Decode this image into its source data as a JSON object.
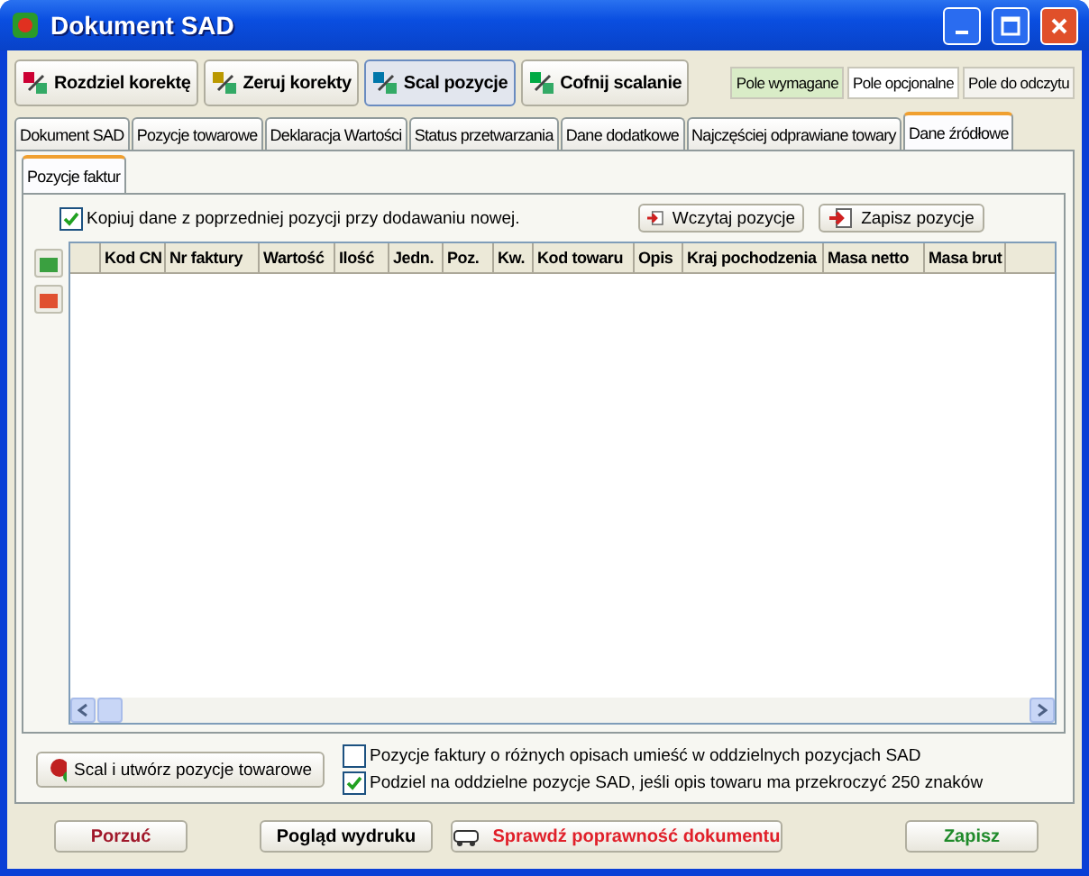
{
  "window": {
    "title": "Dokument SAD"
  },
  "toolbar": [
    {
      "label": "Rozdziel korektę",
      "pressed": false
    },
    {
      "label": "Zeruj korekty",
      "pressed": false
    },
    {
      "label": "Scal pozycje",
      "pressed": true
    },
    {
      "label": "Cofnij scalanie",
      "pressed": false
    }
  ],
  "legend": [
    {
      "label": "Pole wymagane",
      "color": "#d9ecc7"
    },
    {
      "label": "Pole opcjonalne",
      "color": "#ffffff"
    },
    {
      "label": "Pole do odczytu",
      "color": "#f4f3ee"
    }
  ],
  "tabs": [
    {
      "label": "Dokument SAD",
      "selected": false
    },
    {
      "label": "Pozycje towarowe",
      "selected": false
    },
    {
      "label": "Deklaracja Wartości",
      "selected": false
    },
    {
      "label": "Status przetwarzania",
      "selected": false
    },
    {
      "label": "Dane dodatkowe",
      "selected": false
    },
    {
      "label": "Najczęściej odprawiane towary",
      "selected": false
    },
    {
      "label": "Dane źródłowe",
      "selected": true
    }
  ],
  "subtabs": [
    {
      "label": "Pozycje faktur",
      "selected": true
    }
  ],
  "copy_option": {
    "label": "Kopiuj dane z poprzedniej pozycji przy dodawaniu nowej.",
    "checked": true
  },
  "grid_buttons": [
    "Wczytaj pozycje",
    "Zapisz pozycje"
  ],
  "table": {
    "columns": [
      "Kod CN",
      "Nr faktury",
      "Wartość",
      "Ilość",
      "Jedn.",
      "Poz.",
      "Kw.",
      "Kod towaru",
      "Opis",
      "Kraj pochodzenia",
      "Masa netto",
      "Masa brut"
    ]
  },
  "merge_button": "Scal i utwórz pozycje towarowe",
  "options": [
    {
      "label": "Pozycje faktury o różnych opisach umieść w oddzielnych pozycjach SAD",
      "checked": false
    },
    {
      "label": "Podziel na oddzielne pozycje SAD, jeśli opis towaru ma przekroczyć 250 znaków",
      "checked": true
    }
  ],
  "footer": [
    {
      "label": "Porzuć",
      "color": "#a0182a"
    },
    {
      "label": "Pogląd wydruku",
      "color": "#000000"
    },
    {
      "label": "Sprawdź poprawność dokumentu",
      "color": "#e0202a",
      "icon": true
    },
    {
      "label": "Zapisz",
      "color": "#1f8a2a"
    }
  ]
}
